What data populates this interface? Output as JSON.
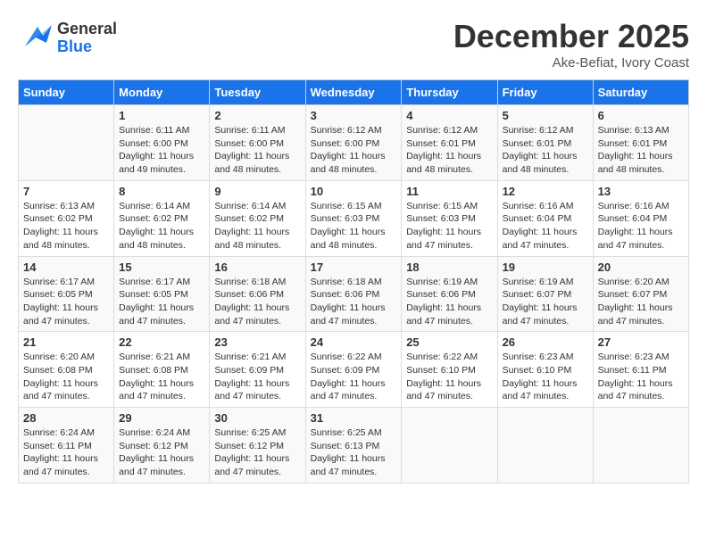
{
  "header": {
    "logo_general": "General",
    "logo_blue": "Blue",
    "month": "December 2025",
    "location": "Ake-Befiat, Ivory Coast"
  },
  "days_of_week": [
    "Sunday",
    "Monday",
    "Tuesday",
    "Wednesday",
    "Thursday",
    "Friday",
    "Saturday"
  ],
  "weeks": [
    [
      {
        "day": "",
        "info": ""
      },
      {
        "day": "1",
        "info": "Sunrise: 6:11 AM\nSunset: 6:00 PM\nDaylight: 11 hours\nand 49 minutes."
      },
      {
        "day": "2",
        "info": "Sunrise: 6:11 AM\nSunset: 6:00 PM\nDaylight: 11 hours\nand 48 minutes."
      },
      {
        "day": "3",
        "info": "Sunrise: 6:12 AM\nSunset: 6:00 PM\nDaylight: 11 hours\nand 48 minutes."
      },
      {
        "day": "4",
        "info": "Sunrise: 6:12 AM\nSunset: 6:01 PM\nDaylight: 11 hours\nand 48 minutes."
      },
      {
        "day": "5",
        "info": "Sunrise: 6:12 AM\nSunset: 6:01 PM\nDaylight: 11 hours\nand 48 minutes."
      },
      {
        "day": "6",
        "info": "Sunrise: 6:13 AM\nSunset: 6:01 PM\nDaylight: 11 hours\nand 48 minutes."
      }
    ],
    [
      {
        "day": "7",
        "info": "Sunrise: 6:13 AM\nSunset: 6:02 PM\nDaylight: 11 hours\nand 48 minutes."
      },
      {
        "day": "8",
        "info": "Sunrise: 6:14 AM\nSunset: 6:02 PM\nDaylight: 11 hours\nand 48 minutes."
      },
      {
        "day": "9",
        "info": "Sunrise: 6:14 AM\nSunset: 6:02 PM\nDaylight: 11 hours\nand 48 minutes."
      },
      {
        "day": "10",
        "info": "Sunrise: 6:15 AM\nSunset: 6:03 PM\nDaylight: 11 hours\nand 48 minutes."
      },
      {
        "day": "11",
        "info": "Sunrise: 6:15 AM\nSunset: 6:03 PM\nDaylight: 11 hours\nand 47 minutes."
      },
      {
        "day": "12",
        "info": "Sunrise: 6:16 AM\nSunset: 6:04 PM\nDaylight: 11 hours\nand 47 minutes."
      },
      {
        "day": "13",
        "info": "Sunrise: 6:16 AM\nSunset: 6:04 PM\nDaylight: 11 hours\nand 47 minutes."
      }
    ],
    [
      {
        "day": "14",
        "info": "Sunrise: 6:17 AM\nSunset: 6:05 PM\nDaylight: 11 hours\nand 47 minutes."
      },
      {
        "day": "15",
        "info": "Sunrise: 6:17 AM\nSunset: 6:05 PM\nDaylight: 11 hours\nand 47 minutes."
      },
      {
        "day": "16",
        "info": "Sunrise: 6:18 AM\nSunset: 6:06 PM\nDaylight: 11 hours\nand 47 minutes."
      },
      {
        "day": "17",
        "info": "Sunrise: 6:18 AM\nSunset: 6:06 PM\nDaylight: 11 hours\nand 47 minutes."
      },
      {
        "day": "18",
        "info": "Sunrise: 6:19 AM\nSunset: 6:06 PM\nDaylight: 11 hours\nand 47 minutes."
      },
      {
        "day": "19",
        "info": "Sunrise: 6:19 AM\nSunset: 6:07 PM\nDaylight: 11 hours\nand 47 minutes."
      },
      {
        "day": "20",
        "info": "Sunrise: 6:20 AM\nSunset: 6:07 PM\nDaylight: 11 hours\nand 47 minutes."
      }
    ],
    [
      {
        "day": "21",
        "info": "Sunrise: 6:20 AM\nSunset: 6:08 PM\nDaylight: 11 hours\nand 47 minutes."
      },
      {
        "day": "22",
        "info": "Sunrise: 6:21 AM\nSunset: 6:08 PM\nDaylight: 11 hours\nand 47 minutes."
      },
      {
        "day": "23",
        "info": "Sunrise: 6:21 AM\nSunset: 6:09 PM\nDaylight: 11 hours\nand 47 minutes."
      },
      {
        "day": "24",
        "info": "Sunrise: 6:22 AM\nSunset: 6:09 PM\nDaylight: 11 hours\nand 47 minutes."
      },
      {
        "day": "25",
        "info": "Sunrise: 6:22 AM\nSunset: 6:10 PM\nDaylight: 11 hours\nand 47 minutes."
      },
      {
        "day": "26",
        "info": "Sunrise: 6:23 AM\nSunset: 6:10 PM\nDaylight: 11 hours\nand 47 minutes."
      },
      {
        "day": "27",
        "info": "Sunrise: 6:23 AM\nSunset: 6:11 PM\nDaylight: 11 hours\nand 47 minutes."
      }
    ],
    [
      {
        "day": "28",
        "info": "Sunrise: 6:24 AM\nSunset: 6:11 PM\nDaylight: 11 hours\nand 47 minutes."
      },
      {
        "day": "29",
        "info": "Sunrise: 6:24 AM\nSunset: 6:12 PM\nDaylight: 11 hours\nand 47 minutes."
      },
      {
        "day": "30",
        "info": "Sunrise: 6:25 AM\nSunset: 6:12 PM\nDaylight: 11 hours\nand 47 minutes."
      },
      {
        "day": "31",
        "info": "Sunrise: 6:25 AM\nSunset: 6:13 PM\nDaylight: 11 hours\nand 47 minutes."
      },
      {
        "day": "",
        "info": ""
      },
      {
        "day": "",
        "info": ""
      },
      {
        "day": "",
        "info": ""
      }
    ]
  ]
}
